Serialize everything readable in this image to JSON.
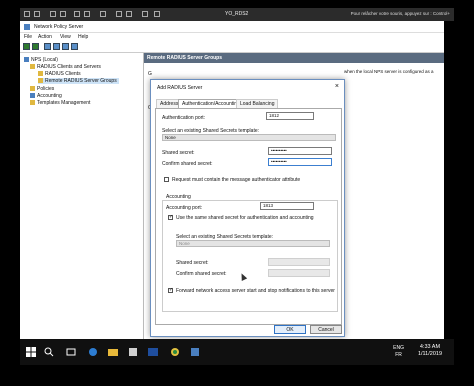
{
  "vm": {
    "title": "YO_RDS2",
    "hint": "Pour relâcher votre souris, appuyez sur : Control+"
  },
  "nps": {
    "title": "Network Policy Server",
    "menu": [
      "File",
      "Action",
      "View",
      "Help"
    ],
    "tree": {
      "root": "NPS (Local)",
      "radius_group": "RADIUS Clients and Servers",
      "radius_clients": "RADIUS Clients",
      "remote_groups": "Remote RADIUS Server Groups",
      "policies": "Policies",
      "accounting": "Accounting",
      "templates": "Templates Management"
    },
    "main_header": "Remote RADIUS Server Groups",
    "main_text": "when the local NPS server is configured as a",
    "side_letters": [
      "G",
      "G"
    ]
  },
  "dialog": {
    "title": "Add RADIUS Server",
    "close": "×",
    "tabs": [
      "Address",
      "Authentication/Accounting",
      "Load Balancing"
    ],
    "auth_port_label": "Authentication port:",
    "auth_port_value": "1812",
    "shared_secret_template_label": "Select an existing Shared Secrets template:",
    "template_value": "None",
    "shared_secret_label": "Shared secret:",
    "shared_secret_value": "••••••••••",
    "confirm_secret_label": "Confirm shared secret:",
    "confirm_secret_value": "••••••••••",
    "request_auth_attr_label": "Request must contain the message authenticator attribute",
    "accounting_group_label": "Accounting",
    "acct_port_label": "Accounting port:",
    "acct_port_value": "1813",
    "same_secret_label": "Use the same shared secret for authentication and accounting",
    "acct_template_label": "Select an existing Shared Secrets template:",
    "acct_template_value": "None",
    "acct_shared_secret_label": "Shared secret:",
    "acct_confirm_label": "Confirm shared secret:",
    "forward_label": "Forward network access server start and stop notifications to this server",
    "ok_label": "OK",
    "cancel_label": "Cancel"
  },
  "taskbar": {
    "lang_top": "ENG",
    "lang_bottom": "FR",
    "time": "4:33 AM",
    "date": "1/11/2019"
  }
}
